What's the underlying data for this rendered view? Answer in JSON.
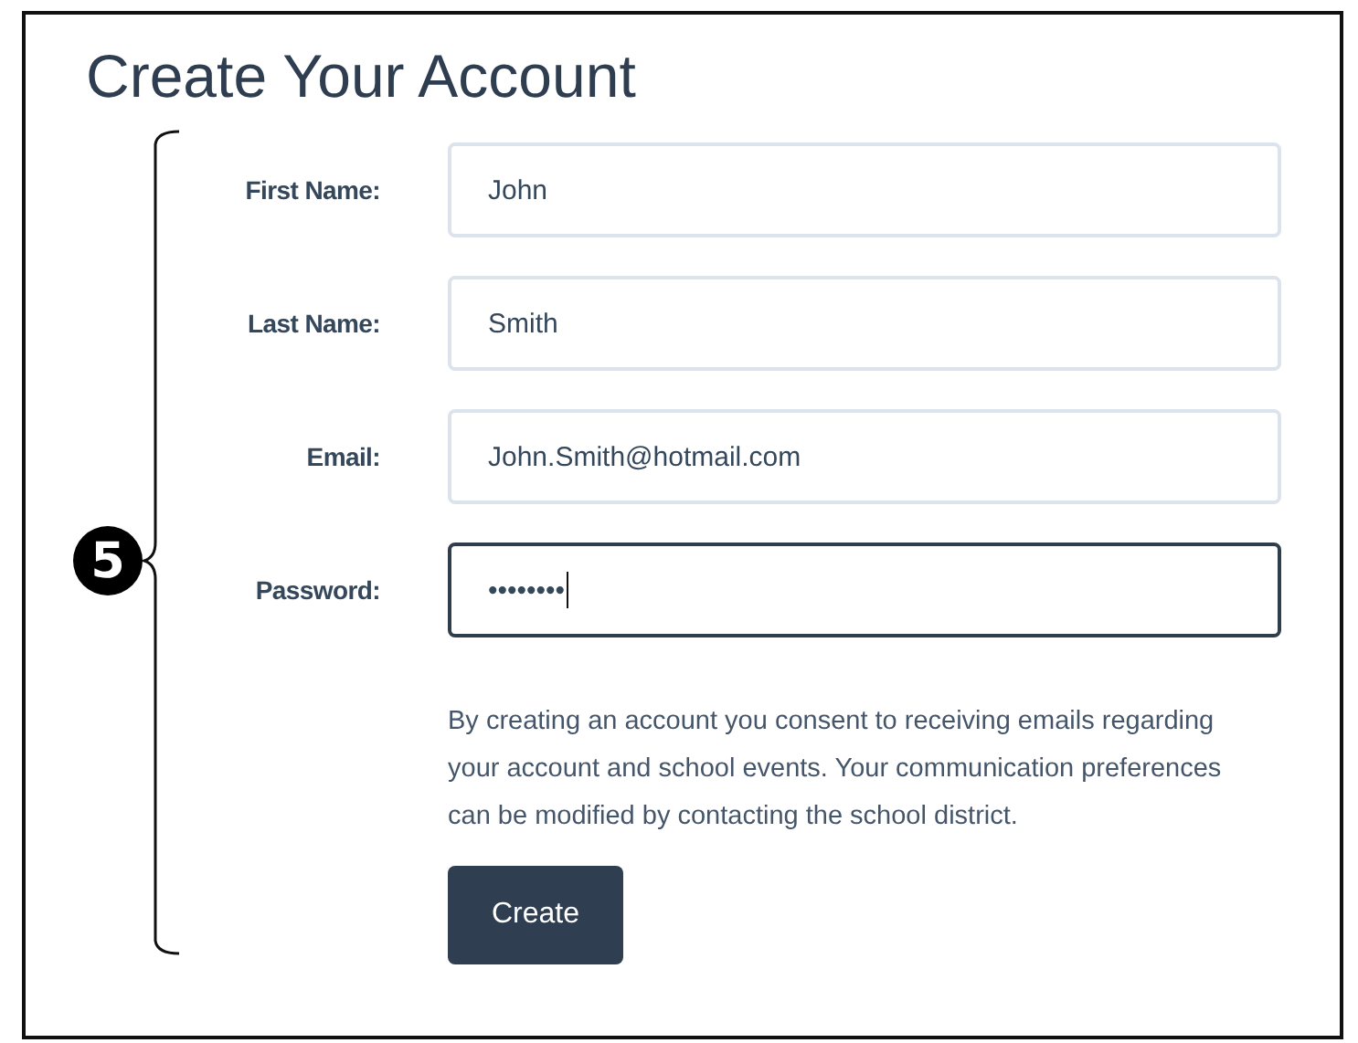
{
  "title": "Create Your Account",
  "fields": [
    {
      "label": "First Name:",
      "value": "John",
      "focused": false
    },
    {
      "label": "Last Name:",
      "value": "Smith",
      "focused": false
    },
    {
      "label": "Email:",
      "value": "John.Smith@hotmail.com",
      "focused": false
    },
    {
      "label": "Password:",
      "value": "••••••••",
      "focused": true
    }
  ],
  "consent_text": "By creating an account you consent to receiving emails regarding your account and school events. Your communication preferences can be modified by contacting the school district.",
  "button": "Create",
  "callout": "5"
}
